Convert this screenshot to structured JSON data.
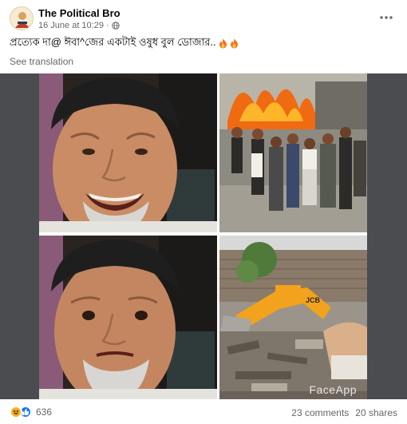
{
  "post": {
    "page_name": "The Political Bro",
    "date": "16 June at 10:29",
    "separator": "·",
    "caption": "প্রত্যেক দা@ ঈবা^জের একটাই ওষুধ বুল ডোজার..",
    "see_translation": "See translation",
    "audience_icon": "globe-icon",
    "more_icon": "more-options-icon"
  },
  "media": {
    "watermark": "FaceApp",
    "images": [
      {
        "name": "smiling-elderly-man-photo"
      },
      {
        "name": "street-fire-crowd-photo"
      },
      {
        "name": "worried-elderly-man-photo"
      },
      {
        "name": "bulldozer-demolition-photo"
      }
    ]
  },
  "footer": {
    "reaction_icons": [
      "haha-reaction-icon",
      "like-reaction-icon"
    ],
    "reaction_count": "636",
    "comments": "23 comments",
    "shares": "20 shares"
  },
  "colors": {
    "text_primary": "#050505",
    "text_secondary": "#65676b",
    "like_blue": "#1877f2",
    "haha_yellow": "#f7b125",
    "media_bg": "#4a4c50"
  }
}
